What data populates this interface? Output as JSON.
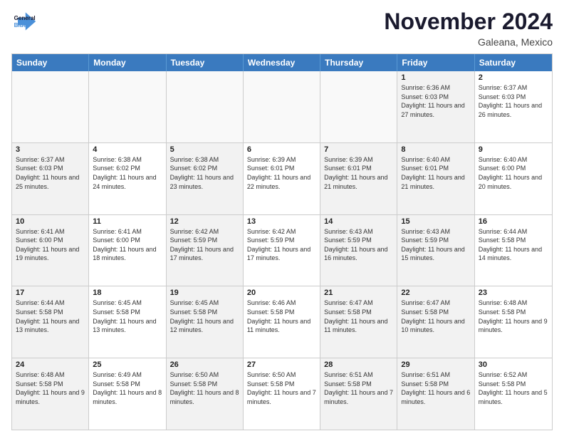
{
  "header": {
    "logo_line1": "General",
    "logo_line2": "Blue",
    "month": "November 2024",
    "location": "Galeana, Mexico"
  },
  "weekdays": [
    "Sunday",
    "Monday",
    "Tuesday",
    "Wednesday",
    "Thursday",
    "Friday",
    "Saturday"
  ],
  "weeks": [
    [
      {
        "day": "",
        "info": "",
        "empty": true
      },
      {
        "day": "",
        "info": "",
        "empty": true
      },
      {
        "day": "",
        "info": "",
        "empty": true
      },
      {
        "day": "",
        "info": "",
        "empty": true
      },
      {
        "day": "",
        "info": "",
        "empty": true
      },
      {
        "day": "1",
        "info": "Sunrise: 6:36 AM\nSunset: 6:03 PM\nDaylight: 11 hours and 27 minutes.",
        "shaded": true
      },
      {
        "day": "2",
        "info": "Sunrise: 6:37 AM\nSunset: 6:03 PM\nDaylight: 11 hours and 26 minutes."
      }
    ],
    [
      {
        "day": "3",
        "info": "Sunrise: 6:37 AM\nSunset: 6:03 PM\nDaylight: 11 hours and 25 minutes.",
        "shaded": true
      },
      {
        "day": "4",
        "info": "Sunrise: 6:38 AM\nSunset: 6:02 PM\nDaylight: 11 hours and 24 minutes."
      },
      {
        "day": "5",
        "info": "Sunrise: 6:38 AM\nSunset: 6:02 PM\nDaylight: 11 hours and 23 minutes.",
        "shaded": true
      },
      {
        "day": "6",
        "info": "Sunrise: 6:39 AM\nSunset: 6:01 PM\nDaylight: 11 hours and 22 minutes."
      },
      {
        "day": "7",
        "info": "Sunrise: 6:39 AM\nSunset: 6:01 PM\nDaylight: 11 hours and 21 minutes.",
        "shaded": true
      },
      {
        "day": "8",
        "info": "Sunrise: 6:40 AM\nSunset: 6:01 PM\nDaylight: 11 hours and 21 minutes.",
        "shaded": true
      },
      {
        "day": "9",
        "info": "Sunrise: 6:40 AM\nSunset: 6:00 PM\nDaylight: 11 hours and 20 minutes."
      }
    ],
    [
      {
        "day": "10",
        "info": "Sunrise: 6:41 AM\nSunset: 6:00 PM\nDaylight: 11 hours and 19 minutes.",
        "shaded": true
      },
      {
        "day": "11",
        "info": "Sunrise: 6:41 AM\nSunset: 6:00 PM\nDaylight: 11 hours and 18 minutes."
      },
      {
        "day": "12",
        "info": "Sunrise: 6:42 AM\nSunset: 5:59 PM\nDaylight: 11 hours and 17 minutes.",
        "shaded": true
      },
      {
        "day": "13",
        "info": "Sunrise: 6:42 AM\nSunset: 5:59 PM\nDaylight: 11 hours and 17 minutes."
      },
      {
        "day": "14",
        "info": "Sunrise: 6:43 AM\nSunset: 5:59 PM\nDaylight: 11 hours and 16 minutes.",
        "shaded": true
      },
      {
        "day": "15",
        "info": "Sunrise: 6:43 AM\nSunset: 5:59 PM\nDaylight: 11 hours and 15 minutes.",
        "shaded": true
      },
      {
        "day": "16",
        "info": "Sunrise: 6:44 AM\nSunset: 5:58 PM\nDaylight: 11 hours and 14 minutes."
      }
    ],
    [
      {
        "day": "17",
        "info": "Sunrise: 6:44 AM\nSunset: 5:58 PM\nDaylight: 11 hours and 13 minutes.",
        "shaded": true
      },
      {
        "day": "18",
        "info": "Sunrise: 6:45 AM\nSunset: 5:58 PM\nDaylight: 11 hours and 13 minutes."
      },
      {
        "day": "19",
        "info": "Sunrise: 6:45 AM\nSunset: 5:58 PM\nDaylight: 11 hours and 12 minutes.",
        "shaded": true
      },
      {
        "day": "20",
        "info": "Sunrise: 6:46 AM\nSunset: 5:58 PM\nDaylight: 11 hours and 11 minutes."
      },
      {
        "day": "21",
        "info": "Sunrise: 6:47 AM\nSunset: 5:58 PM\nDaylight: 11 hours and 11 minutes.",
        "shaded": true
      },
      {
        "day": "22",
        "info": "Sunrise: 6:47 AM\nSunset: 5:58 PM\nDaylight: 11 hours and 10 minutes.",
        "shaded": true
      },
      {
        "day": "23",
        "info": "Sunrise: 6:48 AM\nSunset: 5:58 PM\nDaylight: 11 hours and 9 minutes."
      }
    ],
    [
      {
        "day": "24",
        "info": "Sunrise: 6:48 AM\nSunset: 5:58 PM\nDaylight: 11 hours and 9 minutes.",
        "shaded": true
      },
      {
        "day": "25",
        "info": "Sunrise: 6:49 AM\nSunset: 5:58 PM\nDaylight: 11 hours and 8 minutes."
      },
      {
        "day": "26",
        "info": "Sunrise: 6:50 AM\nSunset: 5:58 PM\nDaylight: 11 hours and 8 minutes.",
        "shaded": true
      },
      {
        "day": "27",
        "info": "Sunrise: 6:50 AM\nSunset: 5:58 PM\nDaylight: 11 hours and 7 minutes."
      },
      {
        "day": "28",
        "info": "Sunrise: 6:51 AM\nSunset: 5:58 PM\nDaylight: 11 hours and 7 minutes.",
        "shaded": true
      },
      {
        "day": "29",
        "info": "Sunrise: 6:51 AM\nSunset: 5:58 PM\nDaylight: 11 hours and 6 minutes.",
        "shaded": true
      },
      {
        "day": "30",
        "info": "Sunrise: 6:52 AM\nSunset: 5:58 PM\nDaylight: 11 hours and 5 minutes."
      }
    ]
  ]
}
